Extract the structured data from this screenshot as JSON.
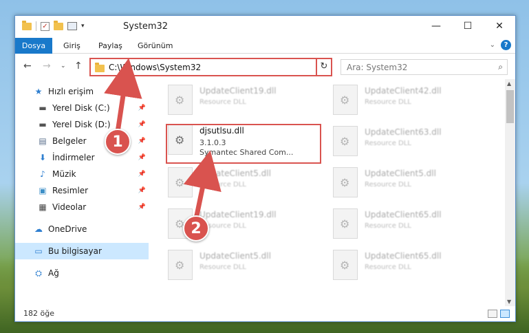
{
  "window": {
    "title": "System32",
    "controls": {
      "minimize": "—",
      "maximize": "☐",
      "close": "✕"
    }
  },
  "ribbon": {
    "file_tab": "Dosya",
    "tabs": [
      "Giriş",
      "Paylaş",
      "Görünüm"
    ]
  },
  "address": {
    "path": "C:\\Windows\\System32",
    "search_placeholder": "Ara: System32"
  },
  "nav": {
    "quick_access": "Hızlı erişim",
    "items": [
      {
        "label": "Yerel Disk (C:)"
      },
      {
        "label": "Yerel Disk (D:)"
      },
      {
        "label": "Belgeler"
      },
      {
        "label": "İndirmeler"
      },
      {
        "label": "Müzik"
      },
      {
        "label": "Resimler"
      },
      {
        "label": "Videolar"
      }
    ],
    "onedrive": "OneDrive",
    "this_pc": "Bu bilgisayar",
    "network": "Ağ"
  },
  "files": {
    "left": [
      {
        "name": "UpdateClient19.dll",
        "type": "Resource DLL"
      },
      {
        "name": "UpdateClient5.dll",
        "type": "Resource DLL"
      },
      {
        "name": "UpdateClient19.dll",
        "type": "Resource DLL"
      },
      {
        "name": "UpdateClient5.dll",
        "type": "Resource DLL"
      }
    ],
    "right": [
      {
        "name": "UpdateClient42.dll",
        "type": "Resource DLL"
      },
      {
        "name": "UpdateClient63.dll",
        "type": "Resource DLL"
      },
      {
        "name": "UpdateClient5.dll",
        "type": "Resource DLL"
      },
      {
        "name": "UpdateClient65.dll",
        "type": "Resource DLL"
      },
      {
        "name": "UpdateClient65.dll",
        "type": "Resource DLL"
      }
    ],
    "highlighted": {
      "name": "djsutlsu.dll",
      "version": "3.1.0.3",
      "company": "Symantec Shared Com..."
    }
  },
  "status": {
    "item_count": "182 öğe"
  },
  "markers": {
    "one": "1",
    "two": "2"
  },
  "colors": {
    "accent": "#1979ca",
    "highlight": "#d9534f",
    "selected": "#cce8ff"
  }
}
